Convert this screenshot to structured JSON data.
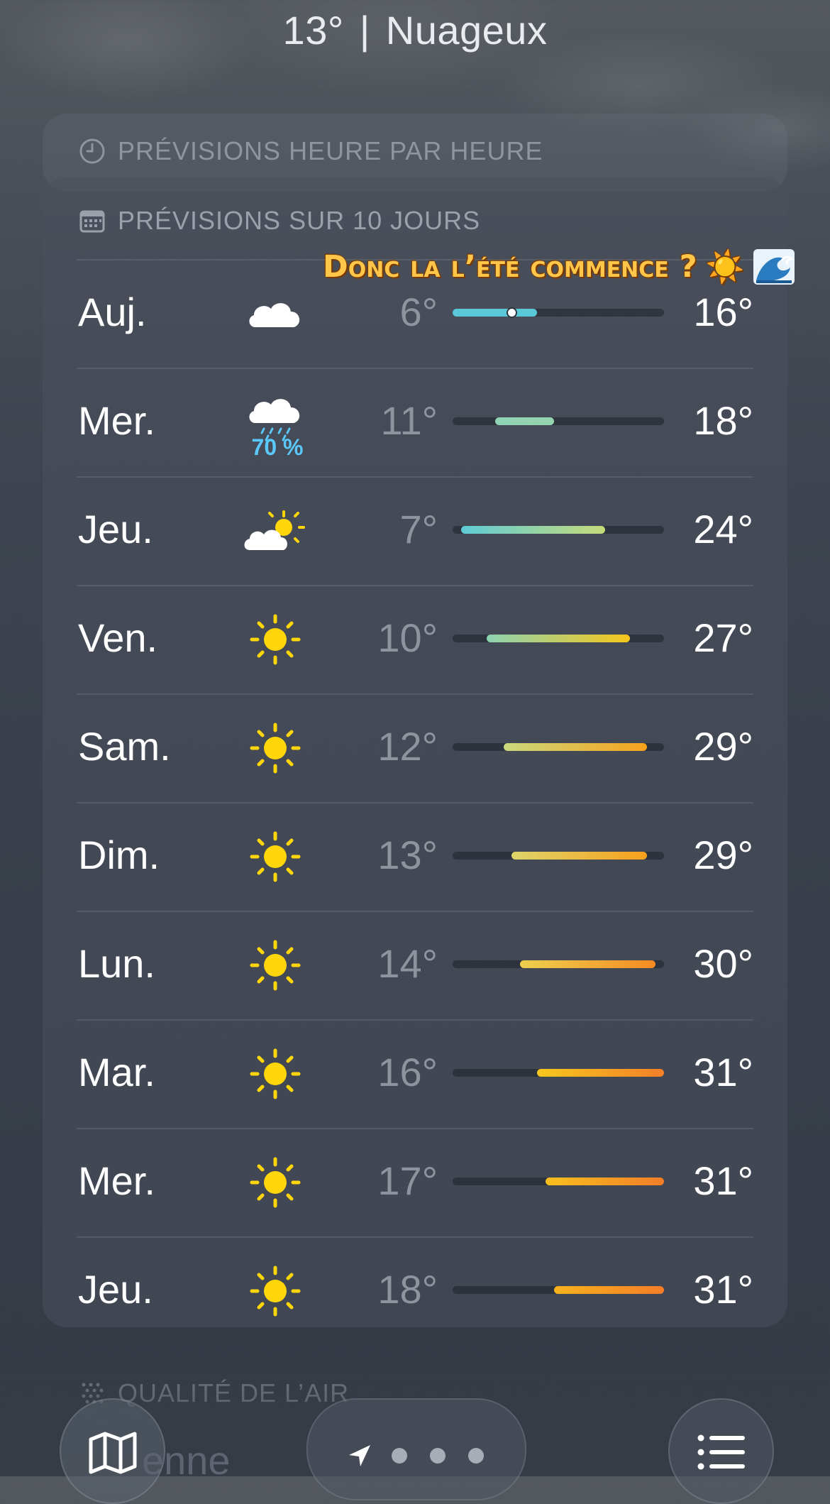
{
  "header": {
    "temperature": "13°",
    "separator": "|",
    "condition": "Nuageux"
  },
  "hourly": {
    "title": "PRÉVISIONS HEURE PAR HEURE"
  },
  "forecast": {
    "title": "PRÉVISIONS SUR 10 JOURS",
    "scale_min": 6,
    "scale_max": 31,
    "current_temp": 13,
    "days": [
      {
        "day": "Auj.",
        "icon": "cloud-icon",
        "precip": "",
        "low": "6°",
        "high": "16°",
        "low_val": 6,
        "high_val": 16,
        "colors": [
          "#5ac8d8",
          "#5ac8d8"
        ],
        "now": true
      },
      {
        "day": "Mer.",
        "icon": "cloud-rain-icon",
        "precip": "70 %",
        "low": "11°",
        "high": "18°",
        "low_val": 11,
        "high_val": 18,
        "colors": [
          "#8fd3b6",
          "#95d4ae"
        ]
      },
      {
        "day": "Jeu.",
        "icon": "partly-sunny-icon",
        "precip": "",
        "low": "7°",
        "high": "24°",
        "low_val": 7,
        "high_val": 24,
        "colors": [
          "#5fcbd6",
          "#c6db7a"
        ]
      },
      {
        "day": "Ven.",
        "icon": "sun-icon",
        "precip": "",
        "low": "10°",
        "high": "27°",
        "low_val": 10,
        "high_val": 27,
        "colors": [
          "#8dd3b2",
          "#f6c61a"
        ]
      },
      {
        "day": "Sam.",
        "icon": "sun-icon",
        "precip": "",
        "low": "12°",
        "high": "29°",
        "low_val": 12,
        "high_val": 29,
        "colors": [
          "#c9d97d",
          "#f7a21c"
        ]
      },
      {
        "day": "Dim.",
        "icon": "sun-icon",
        "precip": "",
        "low": "13°",
        "high": "29°",
        "low_val": 13,
        "high_val": 29,
        "colors": [
          "#ddd56a",
          "#f7a01c"
        ]
      },
      {
        "day": "Lun.",
        "icon": "sun-icon",
        "precip": "",
        "low": "14°",
        "high": "30°",
        "low_val": 14,
        "high_val": 30,
        "colors": [
          "#ecd04e",
          "#f68b22"
        ]
      },
      {
        "day": "Mar.",
        "icon": "sun-icon",
        "precip": "",
        "low": "16°",
        "high": "31°",
        "low_val": 16,
        "high_val": 31,
        "colors": [
          "#f7c81e",
          "#f57f28"
        ]
      },
      {
        "day": "Mer.",
        "icon": "sun-icon",
        "precip": "",
        "low": "17°",
        "high": "31°",
        "low_val": 17,
        "high_val": 31,
        "colors": [
          "#f8c01e",
          "#f47d28"
        ]
      },
      {
        "day": "Jeu.",
        "icon": "sun-icon",
        "precip": "",
        "low": "18°",
        "high": "31°",
        "low_val": 18,
        "high_val": 31,
        "colors": [
          "#f8b21e",
          "#f47d28"
        ]
      }
    ]
  },
  "overlay": {
    "text": "Donc la l’été commence ?",
    "emoji": "☀️"
  },
  "air_quality": {
    "title": "QUALITÉ DE L’AIR",
    "value": "enne"
  },
  "colors": {
    "sun": "#ffd60a",
    "precip": "#5ac8fa"
  }
}
